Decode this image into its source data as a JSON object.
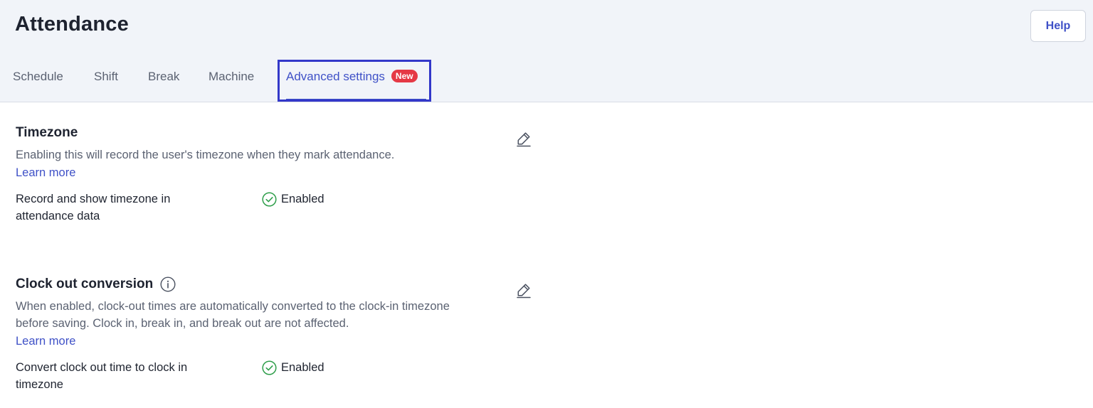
{
  "header": {
    "title": "Attendance",
    "help_label": "Help"
  },
  "tabs": [
    {
      "label": "Schedule"
    },
    {
      "label": "Shift"
    },
    {
      "label": "Break"
    },
    {
      "label": "Machine"
    },
    {
      "label": "Advanced settings",
      "badge": "New",
      "active": true
    }
  ],
  "sections": [
    {
      "title": "Timezone",
      "description": "Enabling this will record the user's timezone when they mark attendance.",
      "learn_more": "Learn more",
      "setting_label": "Record and show timezone in attendance data",
      "status": "Enabled"
    },
    {
      "title": "Clock out conversion",
      "description": "When enabled, clock-out times are automatically converted to the clock-in timezone before saving. Clock in, break in, and break out are not affected.",
      "learn_more": "Learn more",
      "setting_label": "Convert clock out time to clock in timezone",
      "status": "Enabled"
    }
  ],
  "colors": {
    "accent": "#3f51c7",
    "highlight_border": "#3338c9",
    "badge": "#e53945",
    "success": "#2e9e4a",
    "header_bg": "#f1f4f9"
  },
  "icons": {
    "edit": "pencil-icon",
    "status": "check-circle-icon",
    "info": "info-icon"
  }
}
